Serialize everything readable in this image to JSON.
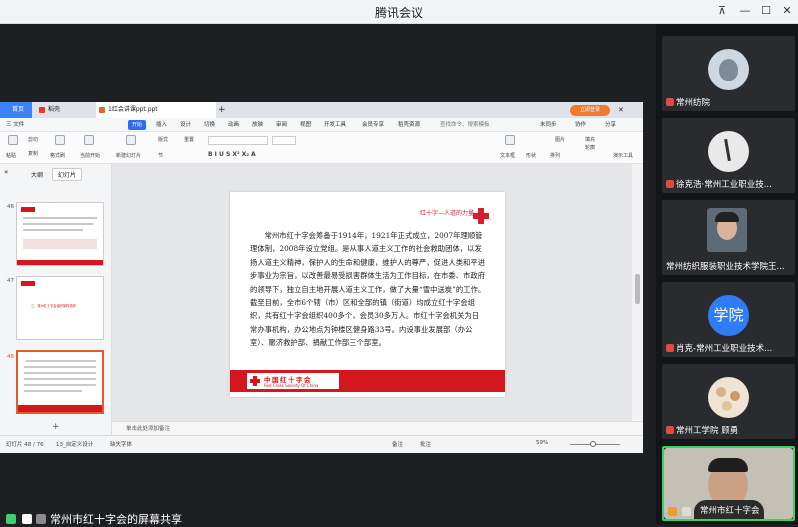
{
  "window": {
    "title": "腾讯会议"
  },
  "wps": {
    "tabs": [
      "首页",
      "稻壳",
      "1红会讲课ppt.ppt"
    ],
    "login": "立即登录",
    "menu": [
      "三 文件",
      "开始",
      "插入",
      "设计",
      "切换",
      "动画",
      "放映",
      "审阅",
      "视图",
      "开发工具",
      "会员专享",
      "稻壳资源",
      "查找命令、搜索模板",
      "未同步",
      "协作",
      "分享"
    ],
    "ribbon": [
      "粘贴",
      "剪切",
      "复制",
      "格式刷",
      "当前开始",
      "新建幻灯片",
      "版式",
      "节",
      "重置",
      "文本框",
      "形状",
      "排列",
      "演示工具",
      "图片",
      "填充",
      "轮廓"
    ],
    "panel_tabs": [
      "大纲",
      "幻灯片"
    ],
    "thumbs": [
      {
        "num": "46",
        "text": "三、常州红十字会组织架构"
      },
      {
        "num": "47",
        "text": "三、常州红十字会组织架构说明"
      },
      {
        "num": "48",
        "text": "常州市红十字会"
      }
    ],
    "slide": {
      "slogan": "红十字—人道的力量",
      "para": "常州市红十字会筹备于1914年，1921年正式成立，2007年理顺管理体制，2008年设立党组。是从事人道主义工作的社会救助团体，以发扬人道主义精神，保护人的生命和健康，维护人的尊严，促进人类和平进步事业为宗旨，以改善最易受损害群体生活为工作目标，在市委、市政府的领导下，独立自主地开展人道主义工作，做了大量“雪中送炭”的工作。截至目前，全市6个辖（市）区和全部的镇（街道）均成立红十字会组织，共有红十字会组织400多个，会员30多万人。市红十字会机关为日常办事机构，办公地点为钟楼区健身路33号。内设事业发展部（办公室）、赈济救护部、捐献工作部三个部室。",
      "logo_cn": "中国红十字会",
      "logo_en": "Red Cross Society Of China"
    },
    "notes": "单击此处添加备注",
    "status": {
      "slide": "幻灯片 48 / 76",
      "theme": "13_自定义设计",
      "font": "缺失字体",
      "note": "备注",
      "comment": "批注",
      "zoom": "59%"
    }
  },
  "share": {
    "text": "常州市红十字会的屏幕共享"
  },
  "participants": [
    {
      "name": "常州纺院",
      "kind": "avatar"
    },
    {
      "name": "徐克浩·常州工业职业技...",
      "kind": "avatar"
    },
    {
      "name": "常州纺织服装职业技术学院王...",
      "kind": "camera"
    },
    {
      "name": "肖克-常州工业职业技术...",
      "kind": "text",
      "avatar_text": "学院"
    },
    {
      "name": "常州工学院 顾勇",
      "kind": "avatar"
    },
    {
      "name": "常州市红十字会",
      "kind": "camera"
    }
  ],
  "colors": {
    "accent": "#2f6df0",
    "red": "#d4161e",
    "active": "#3ccf6a",
    "login": "#ef7a2f"
  }
}
